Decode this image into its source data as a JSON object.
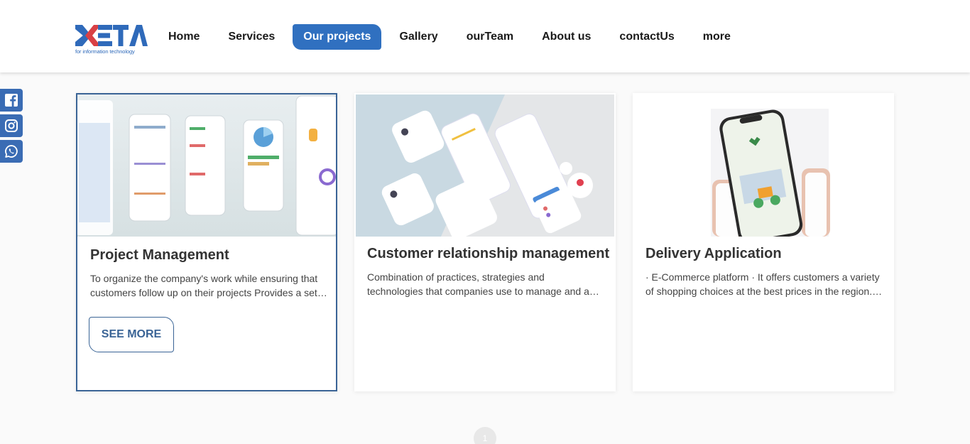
{
  "logo": {
    "text": "META",
    "subtitle": "for information technology"
  },
  "nav": {
    "items": [
      {
        "label": "Home"
      },
      {
        "label": "Services"
      },
      {
        "label": "Our projects",
        "active": true
      },
      {
        "label": "Gallery"
      },
      {
        "label": "ourTeam"
      },
      {
        "label": "About us"
      },
      {
        "label": "contactUs"
      },
      {
        "label": "more"
      }
    ]
  },
  "social": [
    "facebook-icon",
    "instagram-icon",
    "whatsapp-icon"
  ],
  "colors": {
    "accent": "#3070c0",
    "card_border": "#3a6496",
    "social_bg": "#3a6cb4"
  },
  "projects": [
    {
      "title": "Project Management",
      "desc_line1": "To organize the company's work while ensuring that",
      "desc_line2": "customers follow up on their projects Provides a set of tools",
      "button": "SEE MORE"
    },
    {
      "title": "Customer relationship management",
      "desc_line1": "Combination of practices, strategies and",
      "desc_line2": "technologies that companies use to manage and analyze"
    },
    {
      "title": "Delivery Application",
      "desc_line1": "· E-Commerce platform · It offers customers a variety",
      "desc_line2": "of shopping choices at the best prices in the region. It provides"
    }
  ],
  "pagination": {
    "current": "1"
  }
}
